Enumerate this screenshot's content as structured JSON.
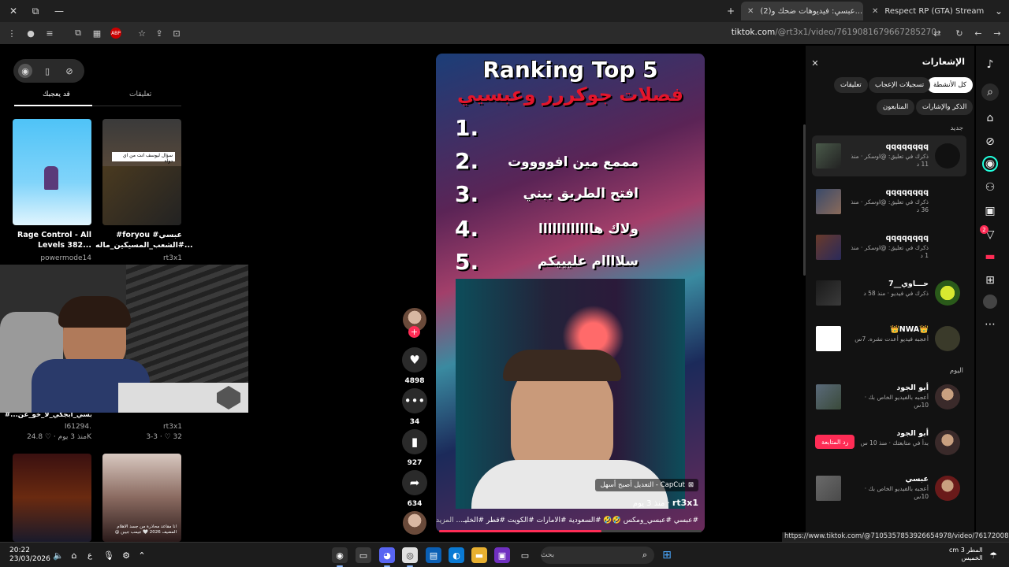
{
  "browser": {
    "tabs": [
      {
        "label": "Respect RP (GTA) Streaming - L",
        "active": false
      },
      {
        "label": "(2)عبسي: فيديوهات ضحك و...",
        "active": true
      }
    ],
    "url_domain": "tiktok.com",
    "url_path": "/@rt3x1/video/7619081679667285270",
    "status_link": "https://www.tiktok.com/@7105357853926654978/video/7617200871733988616"
  },
  "left": {
    "tabs": [
      "قد يعجبك",
      "تعليقات"
    ],
    "videos": [
      {
        "title": "Rage Control - All Levels 382...",
        "author": "powermode14"
      },
      {
        "title": "#foryou #عبسي #الشعب_المسيكين_ماله...",
        "author": "rt3x1"
      },
      {
        "title": "#عبسي_أبجكي_لا_خو_عن... للتسوق 🤍✨ ...",
        "author": "I61294.",
        "likes": "24.8K",
        "age": "منذ 3 يوم"
      },
      {
        "title": "",
        "author": "rt3x1",
        "likes": "32",
        "age": "3-3"
      }
    ],
    "overlay_text": "سؤال ليوسف انت من اي دولة",
    "overlay_text2": "انا مقاعد محاذرة من جسد الاهلام المضيف 2026 🤍 جيمب جيبن @"
  },
  "video": {
    "title": "Ranking Top 5",
    "subtitle": "فصلات جوكررر وعبسيي",
    "ranks": [
      {
        "n": "1.",
        "text": ""
      },
      {
        "n": "2.",
        "text": "مممع مين افووووت"
      },
      {
        "n": "3.",
        "text": "افتح الطريق يبني"
      },
      {
        "n": "4.",
        "text": "ولاك هاااااااااااا"
      },
      {
        "n": "5.",
        "text": "سلاااام عليييكم"
      }
    ],
    "capcut": "CapCut - التعديل أصبح أسهل",
    "author": "rt3x1",
    "age": "منذ 3 يوم",
    "tags": "#عبسي #عبسي_ومكس 🤣🤣 #السعودية #الامارات #الكويت #قطر #الخليـ...",
    "more": "المزيد",
    "progress": 0.62
  },
  "actions": {
    "likes": "4898",
    "comments": "34",
    "saves": "927",
    "shares": "634"
  },
  "notifications": {
    "title": "الإشعارات",
    "chips": [
      "كل الأنشطة",
      "تسجيلات الإعجاب",
      "تعليقات",
      "الذكر والإشارات",
      "المتابعون"
    ],
    "section_new": "جديد",
    "section_today": "اليوم",
    "items": [
      {
        "name": "qqqqqqqq",
        "desc": "ذكرك في تعليق: @اوسكر · منذ 11 د"
      },
      {
        "name": "qqqqqqqq",
        "desc": "ذكرك في تعليق: @اوسكر · منذ 36 د"
      },
      {
        "name": "qqqqqqqq",
        "desc": "ذكرك في تعليق: @اوسكر · منذ 1 د"
      },
      {
        "name": "حـــاوي__7",
        "desc": "ذكرك في فيديو · منذ 58 د"
      },
      {
        "name": "👑NWA👑",
        "desc": "أعجبه فيديو أعدت نشره. 7س"
      },
      {
        "name": "أبو الجود",
        "desc": "أعجبه بالفيديو الخاص بك · 10س"
      },
      {
        "name": "أبو الجود",
        "desc": "بدأ في متابعتك · منذ 10 س",
        "button": "رد المتابعة"
      },
      {
        "name": "عبسي",
        "desc": "أعجبه بالفيديو الخاص بك · 10س"
      }
    ]
  },
  "sidebar": {
    "badge": "2"
  },
  "taskbar": {
    "search_placeholder": "بحث",
    "time": "20:22",
    "date": "23/03/2026",
    "weather_temp": "3 cm",
    "weather_label": "المطر",
    "weather_day": "الخميس",
    "lang": "ع"
  }
}
